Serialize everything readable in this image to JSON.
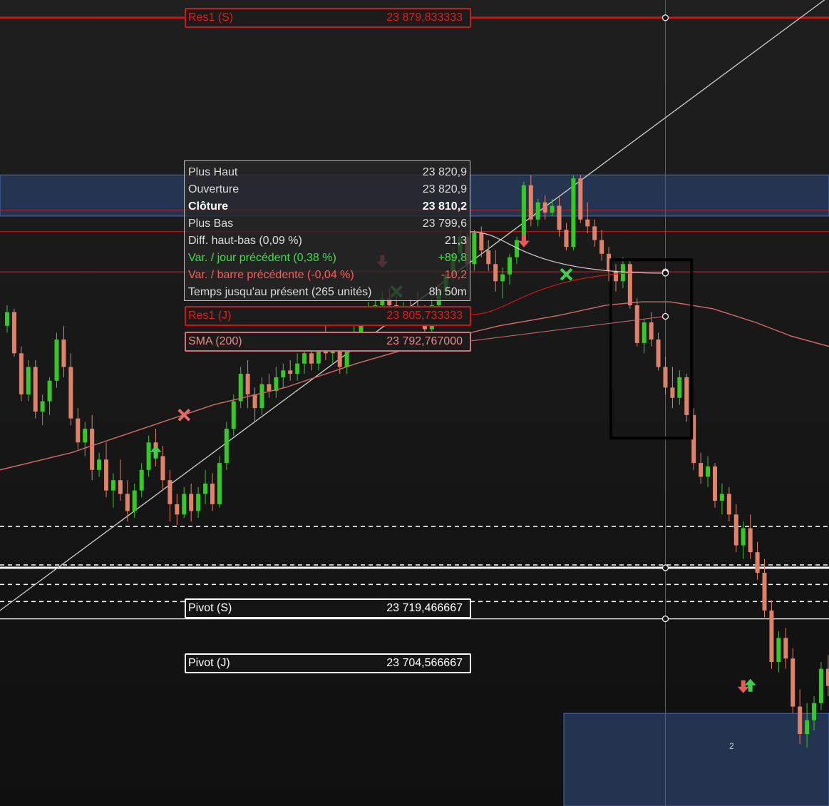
{
  "chart_data": {
    "type": "candlestick",
    "title": "",
    "y_range": [
      23650,
      23885
    ],
    "grid": false,
    "colors": {
      "up": "#35c928",
      "down": "#e0826a",
      "sma": "#d56a6a",
      "resistance": "#d31414",
      "pivot": "#ffffff",
      "zone": "#27395a",
      "trendline": "#cfcfcf",
      "crosshair": "#d03030"
    },
    "candles_ohlc": [
      [
        23790,
        23796,
        23788,
        23794
      ],
      [
        23794,
        23795,
        23781,
        23782
      ],
      [
        23782,
        23784,
        23768,
        23770
      ],
      [
        23770,
        23780,
        23768,
        23778
      ],
      [
        23778,
        23780,
        23763,
        23765
      ],
      [
        23765,
        23770,
        23761,
        23768
      ],
      [
        23768,
        23775,
        23764,
        23774
      ],
      [
        23774,
        23788,
        23772,
        23786
      ],
      [
        23786,
        23790,
        23775,
        23778
      ],
      [
        23778,
        23782,
        23761,
        23763
      ],
      [
        23763,
        23766,
        23754,
        23756
      ],
      [
        23756,
        23762,
        23752,
        23760
      ],
      [
        23760,
        23764,
        23745,
        23748
      ],
      [
        23748,
        23753,
        23746,
        23751
      ],
      [
        23751,
        23756,
        23740,
        23742
      ],
      [
        23742,
        23747,
        23737,
        23745
      ],
      [
        23745,
        23751,
        23739,
        23741
      ],
      [
        23741,
        23745,
        23733,
        23736
      ],
      [
        23736,
        23744,
        23734,
        23742
      ],
      [
        23742,
        23750,
        23740,
        23748
      ],
      [
        23748,
        23758,
        23746,
        23756
      ],
      [
        23756,
        23760,
        23749,
        23752
      ],
      [
        23752,
        23755,
        23742,
        23745
      ],
      [
        23745,
        23748,
        23733,
        23738
      ],
      [
        23738,
        23741,
        23732,
        23735
      ],
      [
        23735,
        23743,
        23734,
        23741
      ],
      [
        23741,
        23744,
        23733,
        23736
      ],
      [
        23736,
        23743,
        23734,
        23741
      ],
      [
        23741,
        23748,
        23738,
        23744
      ],
      [
        23744,
        23747,
        23736,
        23738
      ],
      [
        23738,
        23752,
        23737,
        23750
      ],
      [
        23750,
        23762,
        23748,
        23760
      ],
      [
        23760,
        23770,
        23758,
        23768
      ],
      [
        23768,
        23778,
        23766,
        23776
      ],
      [
        23776,
        23780,
        23766,
        23770
      ],
      [
        23770,
        23772,
        23762,
        23766
      ],
      [
        23766,
        23775,
        23764,
        23773
      ],
      [
        23773,
        23776,
        23769,
        23771
      ],
      [
        23771,
        23778,
        23769,
        23775
      ],
      [
        23775,
        23779,
        23772,
        23777
      ],
      [
        23777,
        23780,
        23774,
        23776
      ],
      [
        23776,
        23782,
        23774,
        23779
      ],
      [
        23779,
        23784,
        23776,
        23782
      ],
      [
        23782,
        23785,
        23777,
        23779
      ],
      [
        23779,
        23788,
        23777,
        23786
      ],
      [
        23786,
        23790,
        23780,
        23782
      ],
      [
        23782,
        23786,
        23779,
        23784
      ],
      [
        23784,
        23788,
        23776,
        23778
      ],
      [
        23778,
        23786,
        23776,
        23784
      ],
      [
        23784,
        23790,
        23783,
        23787
      ],
      [
        23787,
        23794,
        23785,
        23792
      ],
      [
        23792,
        23797,
        23790,
        23795
      ],
      [
        23795,
        23798,
        23791,
        23796
      ],
      [
        23796,
        23800,
        23793,
        23798
      ],
      [
        23798,
        23801,
        23795,
        23796
      ],
      [
        23796,
        23799,
        23792,
        23794
      ],
      [
        23794,
        23797,
        23790,
        23795
      ],
      [
        23795,
        23798,
        23792,
        23794
      ],
      [
        23794,
        23800,
        23790,
        23793
      ],
      [
        23793,
        23796,
        23787,
        23789
      ],
      [
        23789,
        23798,
        23788,
        23796
      ],
      [
        23796,
        23802,
        23795,
        23800
      ],
      [
        23800,
        23806,
        23798,
        23805
      ],
      [
        23805,
        23813,
        23803,
        23811
      ],
      [
        23811,
        23818,
        23809,
        23816
      ],
      [
        23816,
        23817,
        23806,
        23808
      ],
      [
        23808,
        23818,
        23806,
        23817
      ],
      [
        23817,
        23819,
        23810,
        23812
      ],
      [
        23812,
        23815,
        23806,
        23808
      ],
      [
        23808,
        23812,
        23800,
        23803
      ],
      [
        23803,
        23807,
        23798,
        23805
      ],
      [
        23805,
        23811,
        23802,
        23810
      ],
      [
        23810,
        23816,
        23808,
        23815
      ],
      [
        23815,
        23832,
        23813,
        23831
      ],
      [
        23831,
        23834,
        23819,
        23821
      ],
      [
        23821,
        23827,
        23819,
        23826
      ],
      [
        23826,
        23828,
        23821,
        23823
      ],
      [
        23823,
        23827,
        23822,
        23825
      ],
      [
        23825,
        23828,
        23816,
        23818
      ],
      [
        23818,
        23820,
        23812,
        23813
      ],
      [
        23813,
        23834,
        23812,
        23833
      ],
      [
        23833,
        23834,
        23820,
        23821
      ],
      [
        23821,
        23826,
        23817,
        23819
      ],
      [
        23819,
        23821,
        23813,
        23815
      ],
      [
        23815,
        23818,
        23809,
        23811
      ],
      [
        23811,
        23813,
        23803,
        23806
      ],
      [
        23806,
        23808,
        23800,
        23803
      ],
      [
        23803,
        23810,
        23801,
        23808
      ],
      [
        23808,
        23809,
        23795,
        23796
      ],
      [
        23796,
        23798,
        23784,
        23785
      ],
      [
        23785,
        23792,
        23782,
        23791
      ],
      [
        23791,
        23794,
        23784,
        23786
      ],
      [
        23786,
        23788,
        23777,
        23778
      ],
      [
        23778,
        23781,
        23770,
        23772
      ],
      [
        23772,
        23778,
        23766,
        23769
      ],
      [
        23769,
        23777,
        23767,
        23775
      ],
      [
        23775,
        23776,
        23762,
        23764
      ],
      [
        23764,
        23766,
        23748,
        23750
      ],
      [
        23750,
        23753,
        23744,
        23746
      ],
      [
        23746,
        23752,
        23743,
        23749
      ],
      [
        23749,
        23750,
        23737,
        23739
      ],
      [
        23739,
        23744,
        23735,
        23741
      ],
      [
        23741,
        23743,
        23733,
        23735
      ],
      [
        23735,
        23738,
        23724,
        23726
      ],
      [
        23726,
        23733,
        23722,
        23731
      ],
      [
        23731,
        23735,
        23722,
        23724
      ],
      [
        23724,
        23727,
        23716,
        23718
      ],
      [
        23718,
        23722,
        23705,
        23707
      ],
      [
        23707,
        23710,
        23690,
        23692
      ],
      [
        23692,
        23701,
        23689,
        23699
      ],
      [
        23699,
        23702,
        23690,
        23693
      ],
      [
        23693,
        23696,
        23677,
        23679
      ],
      [
        23679,
        23684,
        23668,
        23671
      ],
      [
        23671,
        23680,
        23667,
        23675
      ],
      [
        23675,
        23682,
        23672,
        23680
      ],
      [
        23680,
        23692,
        23678,
        23690
      ],
      [
        23690,
        23694,
        23682,
        23685
      ],
      [
        23685,
        23701,
        23683,
        23699
      ],
      [
        23699,
        23703,
        23688,
        23690
      ],
      [
        23690,
        23700,
        23686,
        23698
      ],
      [
        23698,
        23705,
        23692,
        23694
      ],
      [
        23694,
        23697,
        23686,
        23688
      ],
      [
        23688,
        23694,
        23686,
        23691
      ],
      [
        23691,
        23696,
        23684,
        23687
      ],
      [
        23687,
        23693,
        23683,
        23690
      ]
    ],
    "sma200": [
      [
        0,
        23748
      ],
      [
        100,
        23753
      ],
      [
        200,
        23760
      ],
      [
        300,
        23767
      ],
      [
        400,
        23772
      ],
      [
        500,
        23779
      ],
      [
        600,
        23785
      ],
      [
        700,
        23790
      ],
      [
        783,
        23793
      ],
      [
        850,
        23796
      ],
      [
        900,
        23797
      ],
      [
        940,
        23797
      ],
      [
        1000,
        23795
      ],
      [
        1060,
        23791
      ],
      [
        1110,
        23787
      ],
      [
        1163,
        23784
      ]
    ],
    "trendline": [
      [
        0,
        23707
      ],
      [
        1163,
        23886
      ]
    ],
    "zones": [
      {
        "x_from": 0,
        "x_to": 1163,
        "y_from": 23834,
        "y_to": 23822
      },
      {
        "x_from": 791,
        "x_to": 1163,
        "y_from": 23677,
        "y_to": 23650
      }
    ],
    "selection_box_bars": [
      86,
      96
    ],
    "crosshair_bar": 93,
    "levels": [
      {
        "name": "Res1 (S)",
        "value_text": "23 879,833333",
        "value": 23879.833333,
        "style": "resistance-thick"
      },
      {
        "name": "Res1 (J)",
        "value_text": "23 805,733333",
        "value": 23805.733333,
        "style": "resistance"
      },
      {
        "name": "Pivot (S)",
        "value_text": "23 719,466667",
        "value": 23719.466667,
        "style": "pivot-thick"
      },
      {
        "name": "Pivot (J)",
        "value_text": "23 704,566667",
        "value": 23704.566667,
        "style": "pivot"
      }
    ],
    "extra_lines": [
      23817.5,
      23823.7
    ],
    "dashed_lines": [
      23731.5,
      23720.3,
      23714.6,
      23709.6
    ],
    "sma_label": {
      "name": "SMA (200)",
      "value_text": "23 792,767000",
      "value": 23792.767
    },
    "markers": [
      {
        "type": "arrow-up",
        "color": "#3fd04b",
        "bar": 21,
        "value": 23753
      },
      {
        "type": "cross",
        "color": "#e86a6a",
        "bar": 25,
        "value": 23764
      },
      {
        "type": "arrow-down",
        "color": "#d25a5a",
        "bar": 53,
        "value": 23809
      },
      {
        "type": "cross",
        "color": "#3fbf4b",
        "bar": 55,
        "value": 23800
      },
      {
        "type": "arrow-down",
        "color": "#e85a5a",
        "bar": 73,
        "value": 23815
      },
      {
        "type": "cross",
        "color": "#3fd04b",
        "bar": 79,
        "value": 23805
      },
      {
        "type": "arrow-down",
        "color": "#e85a5a",
        "bar": 104,
        "value": 23685
      },
      {
        "type": "arrow-up",
        "color": "#3fd04b",
        "bar": 105,
        "value": 23685
      }
    ],
    "marker_count": "2"
  },
  "tooltip": {
    "rows": [
      {
        "label": "Plus Haut",
        "value": "23 820,9"
      },
      {
        "label": "Ouverture",
        "value": "23 820,9"
      },
      {
        "label": "Clôture",
        "value": "23 810,2"
      },
      {
        "label": "Plus Bas",
        "value": "23 799,6"
      },
      {
        "label": "Diff. haut-bas (0,09 %)",
        "value": "21,3"
      },
      {
        "label": "Var. / jour précédent (0,38 %)",
        "value": "+89,8"
      },
      {
        "label": "Var. / barre précédente (-0,04 %)",
        "value": "-10,2"
      },
      {
        "label": "Temps jusqu'au présent (265 unités)",
        "value": "8h 50m"
      }
    ]
  }
}
